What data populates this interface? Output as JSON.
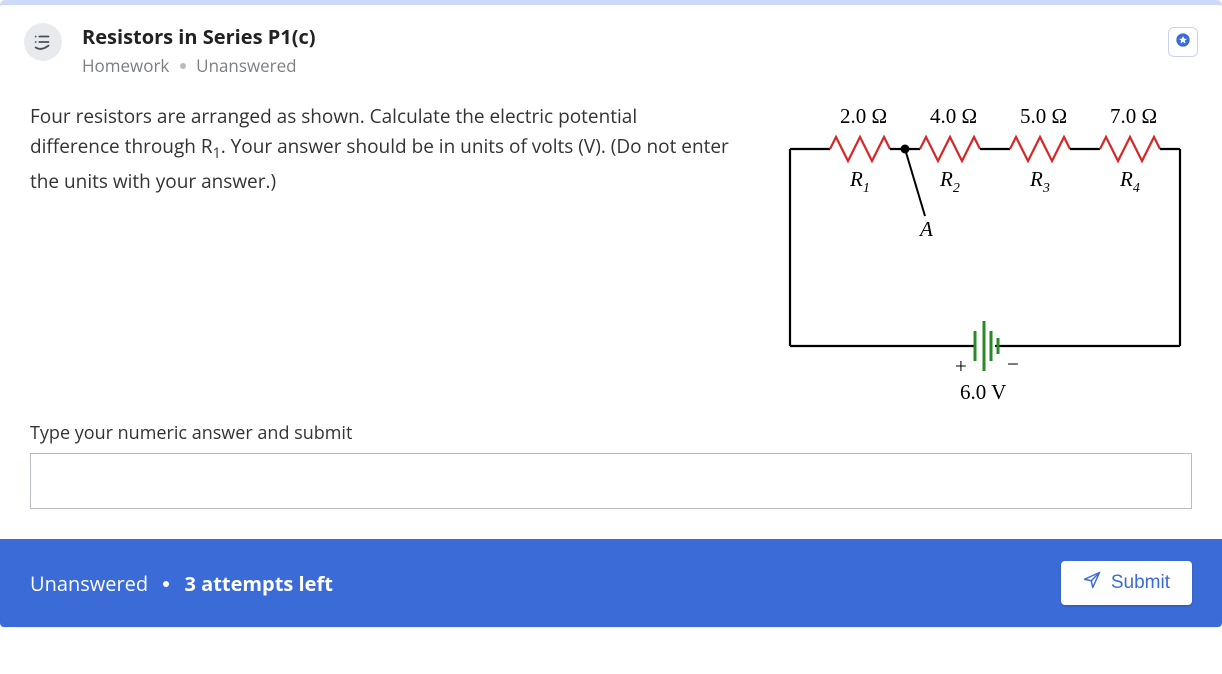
{
  "header": {
    "title": "Resistors in Series P1(c)",
    "category": "Homework",
    "status": "Unanswered"
  },
  "prompt": {
    "text_1": "Four resistors are arranged as shown. Calculate the electric potential difference through R",
    "sub": "1",
    "text_2": ". Your answer should be in units of volts (V). (Do not enter the units with your answer.)"
  },
  "circuit": {
    "r1": {
      "value": "2.0 Ω",
      "label": "R",
      "sub": "1"
    },
    "r2": {
      "value": "4.0 Ω",
      "label": "R",
      "sub": "2"
    },
    "r3": {
      "value": "5.0 Ω",
      "label": "R",
      "sub": "3"
    },
    "r4": {
      "value": "7.0 Ω",
      "label": "R",
      "sub": "4"
    },
    "node": "A",
    "battery_plus": "+",
    "battery_minus": "−",
    "battery_v": "6.0 V"
  },
  "answer": {
    "label": "Type your numeric answer and submit",
    "value": ""
  },
  "footer": {
    "status": "Unanswered",
    "attempts": "3 attempts left",
    "submit": "Submit"
  }
}
